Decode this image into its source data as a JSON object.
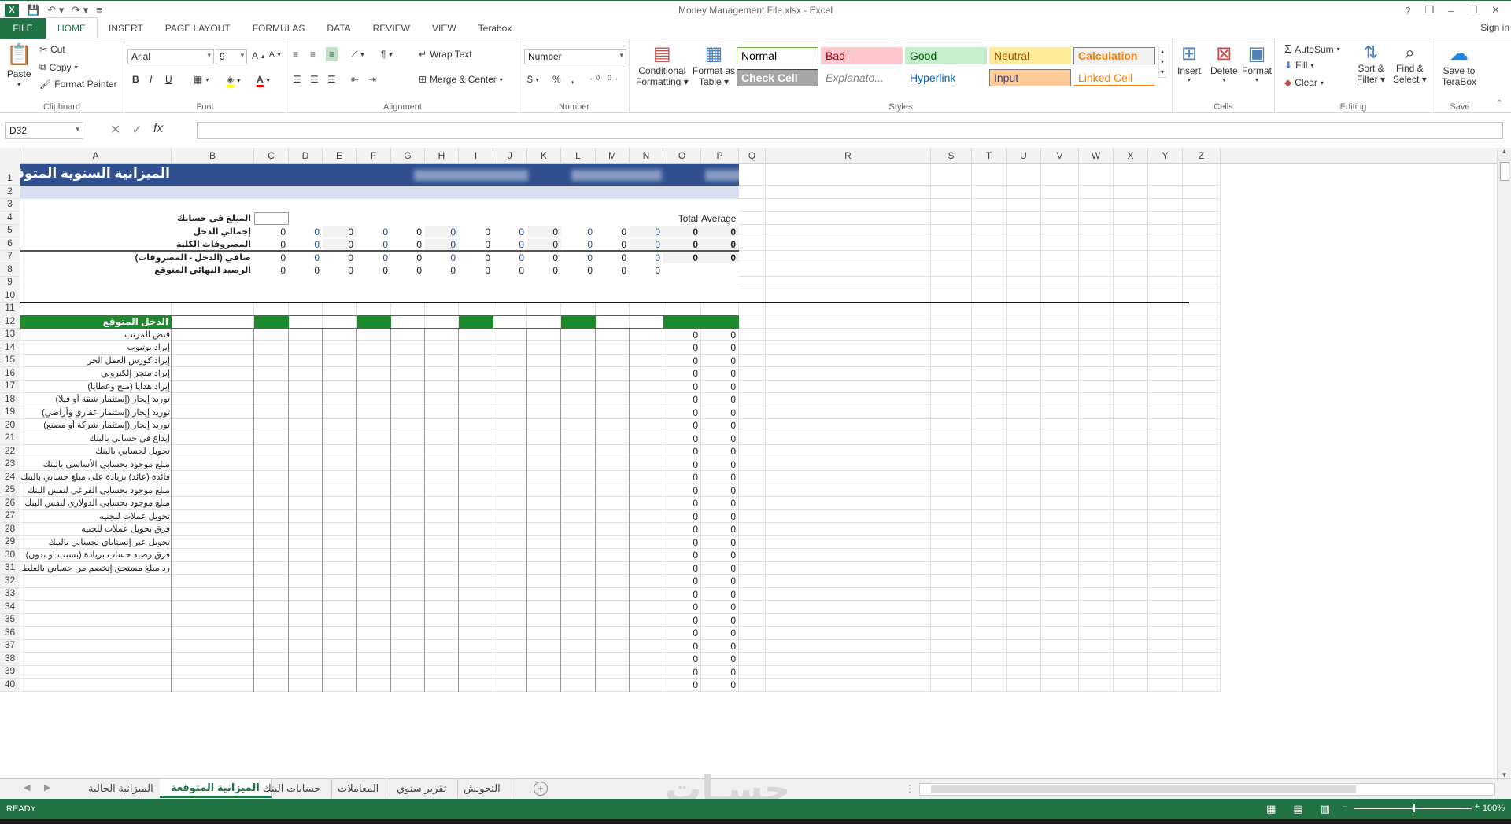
{
  "window": {
    "title": "Money Management File.xlsx - Excel",
    "controls": [
      "?",
      "❐",
      "–",
      "❐",
      "✕"
    ]
  },
  "ribbon_tabs": [
    "FILE",
    "HOME",
    "INSERT",
    "PAGE LAYOUT",
    "FORMULAS",
    "DATA",
    "REVIEW",
    "VIEW",
    "Terabox"
  ],
  "signin": "Sign in",
  "clipboard": {
    "paste": "Paste",
    "cut": "Cut",
    "copy": "Copy",
    "format_painter": "Format Painter",
    "label": "Clipboard"
  },
  "font": {
    "name": "Arial",
    "size": "9",
    "bold": "B",
    "italic": "I",
    "underline": "U",
    "label": "Font"
  },
  "alignment": {
    "wrap_text": "Wrap Text",
    "merge_center": "Merge & Center",
    "label": "Alignment"
  },
  "number": {
    "format": "Number",
    "currency": "$",
    "percent": "%",
    "comma": ",",
    "label": "Number"
  },
  "styles_group": {
    "conditional": "Conditional",
    "formatting": "Formatting",
    "format_as": "Format as",
    "table": "Table",
    "cells": [
      {
        "name": "Normal",
        "bg": "#ffffff",
        "fg": "#000000",
        "border": "#70ad47"
      },
      {
        "name": "Bad",
        "bg": "#ffc7ce",
        "fg": "#9c0006"
      },
      {
        "name": "Good",
        "bg": "#c6efce",
        "fg": "#006100"
      },
      {
        "name": "Neutral",
        "bg": "#ffeb9c",
        "fg": "#9c5700"
      },
      {
        "name": "Calculation",
        "bg": "#f2f2f2",
        "fg": "#fa7d00",
        "border": "#7f7f7f"
      },
      {
        "name": "Check Cell",
        "bg": "#a5a5a5",
        "fg": "#ffffff",
        "border": "#3f3f3f"
      },
      {
        "name": "Explanato...",
        "bg": "#ffffff",
        "fg": "#7f7f7f"
      },
      {
        "name": "Hyperlink",
        "bg": "#ffffff",
        "fg": "#0563c1"
      },
      {
        "name": "Input",
        "bg": "#ffcc99",
        "fg": "#3f3f76",
        "border": "#7f7f7f"
      },
      {
        "name": "Linked Cell",
        "bg": "#ffffff",
        "fg": "#fa7d00"
      }
    ],
    "label": "Styles"
  },
  "cells_group": {
    "insert": "Insert",
    "delete": "Delete",
    "format": "Format",
    "label": "Cells"
  },
  "editing": {
    "autosum": "AutoSum",
    "fill": "Fill",
    "clear": "Clear",
    "sort": "Sort &",
    "filter": "Filter",
    "find": "Find &",
    "select": "Select",
    "label": "Editing"
  },
  "save": {
    "save_to": "Save to",
    "terabox": "TeraBox",
    "label": "Save"
  },
  "formula_bar": {
    "name_box": "D32",
    "cancel": "✕",
    "enter": "✓",
    "fx": "fx",
    "value": ""
  },
  "columns": [
    "A",
    "B",
    "C",
    "D",
    "E",
    "F",
    "G",
    "H",
    "I",
    "J",
    "K",
    "L",
    "M",
    "N",
    "O",
    "P",
    "Q",
    "R",
    "S",
    "T",
    "U",
    "V",
    "W",
    "X",
    "Y",
    "Z"
  ],
  "sheet": {
    "title": "الميزانية السنوية المتوقعة",
    "summary": {
      "headers": {
        "total": "Total",
        "average": "Average"
      },
      "rows": [
        {
          "label": "المبلغ في حسابك",
          "values": []
        },
        {
          "label": "إجمالي الدخل",
          "values": [
            "0",
            "0",
            "0",
            "0",
            "0",
            "0",
            "0",
            "0",
            "0",
            "0",
            "0",
            "0"
          ],
          "total": "0",
          "average": "0"
        },
        {
          "label": "المصروفات الكلية",
          "values": [
            "0",
            "0",
            "0",
            "0",
            "0",
            "0",
            "0",
            "0",
            "0",
            "0",
            "0",
            "0"
          ],
          "total": "0",
          "average": "0"
        },
        {
          "label": "صافي (الدخل - المصروفات)",
          "values": [
            "0",
            "0",
            "0",
            "0",
            "0",
            "0",
            "0",
            "0",
            "0",
            "0",
            "0",
            "0"
          ],
          "total": "0",
          "average": "0"
        },
        {
          "label": "الرصيد النهائي المتوقع",
          "values": [
            "0",
            "0",
            "0",
            "0",
            "0",
            "0",
            "0",
            "0",
            "0",
            "0",
            "0",
            "0"
          ]
        }
      ]
    },
    "income_header": "الدخل المتوقع",
    "income_items": [
      "قبض المرتب",
      "إيراد يوتيوب",
      "إيراد كورس العمل الحر",
      "إيراد متجر إلكتروني",
      "إيراد هدايا (منح وعطايا)",
      "توريد إيجار (إستثمار شقة أو فيلا)",
      "توريد إيجار (إستثمار عقاري وأراضي)",
      "توريد إيجار (إستثمار شركة أو مصنع)",
      "إيداع في حسابي بالبنك",
      "تحويل لحسابي بالبنك",
      "مبلغ موجود بحسابي الأساسي بالبنك",
      "فائدة (عائد) بزيادة على مبلغ حسابي بالبنك",
      "مبلغ موجود بحسابي الفرعي لنفس البنك",
      "مبلغ موجود بحسابي الدولاري لنفس البنك",
      "تحويل عملات للجنيه",
      "فرق تحويل عملات للجنيه",
      "تحويل عبر إنستاباي لحسابي بالبنك",
      "فرق رصيد حساب بزيادة (بسبب أو بدون)",
      "رد مبلغ مستحق إتخصم من حسابي بالغلط"
    ],
    "row_numbers": [
      "1",
      "2",
      "3",
      "4",
      "5",
      "6",
      "7",
      "8",
      "9",
      "10",
      "11",
      "12",
      "13",
      "14",
      "15",
      "16",
      "17",
      "18",
      "19",
      "20",
      "21",
      "22",
      "23",
      "24",
      "25",
      "26",
      "27",
      "28",
      "29",
      "30",
      "31",
      "32",
      "33",
      "34",
      "35",
      "36",
      "37",
      "38",
      "39",
      "40"
    ],
    "zero": "0"
  },
  "sheet_tabs": [
    "الميزانية الحالية",
    "الميزانية المتوقعة",
    "حسابات البنك",
    "المعاملات",
    "تقرير سنوي",
    "التحويش"
  ],
  "active_tab_index": 1,
  "status": {
    "ready": "READY",
    "zoom": "100%"
  },
  "watermark": "حسـات"
}
